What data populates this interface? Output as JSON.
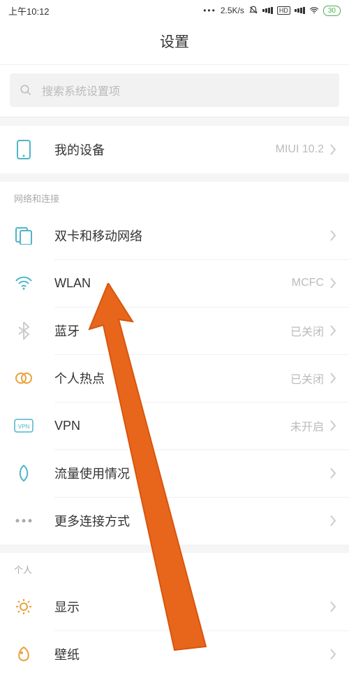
{
  "status": {
    "time": "上午10:12",
    "speed": "2.5K/s",
    "hd_label": "HD",
    "battery": "30"
  },
  "title": "设置",
  "search": {
    "placeholder": "搜索系统设置项"
  },
  "device": {
    "label": "我的设备",
    "value": "MIUI 10.2"
  },
  "section_network_header": "网络和连接",
  "network": {
    "sim": {
      "label": "双卡和移动网络"
    },
    "wlan": {
      "label": "WLAN",
      "value": "MCFC"
    },
    "bluetooth": {
      "label": "蓝牙",
      "value": "已关闭"
    },
    "hotspot": {
      "label": "个人热点",
      "value": "已关闭"
    },
    "vpn": {
      "label": "VPN",
      "value": "未开启"
    },
    "data_usage": {
      "label": "流量使用情况"
    },
    "more": {
      "label": "更多连接方式"
    }
  },
  "section_personal_header": "个人",
  "personal": {
    "display": {
      "label": "显示"
    },
    "wallpaper": {
      "label": "壁纸"
    }
  }
}
